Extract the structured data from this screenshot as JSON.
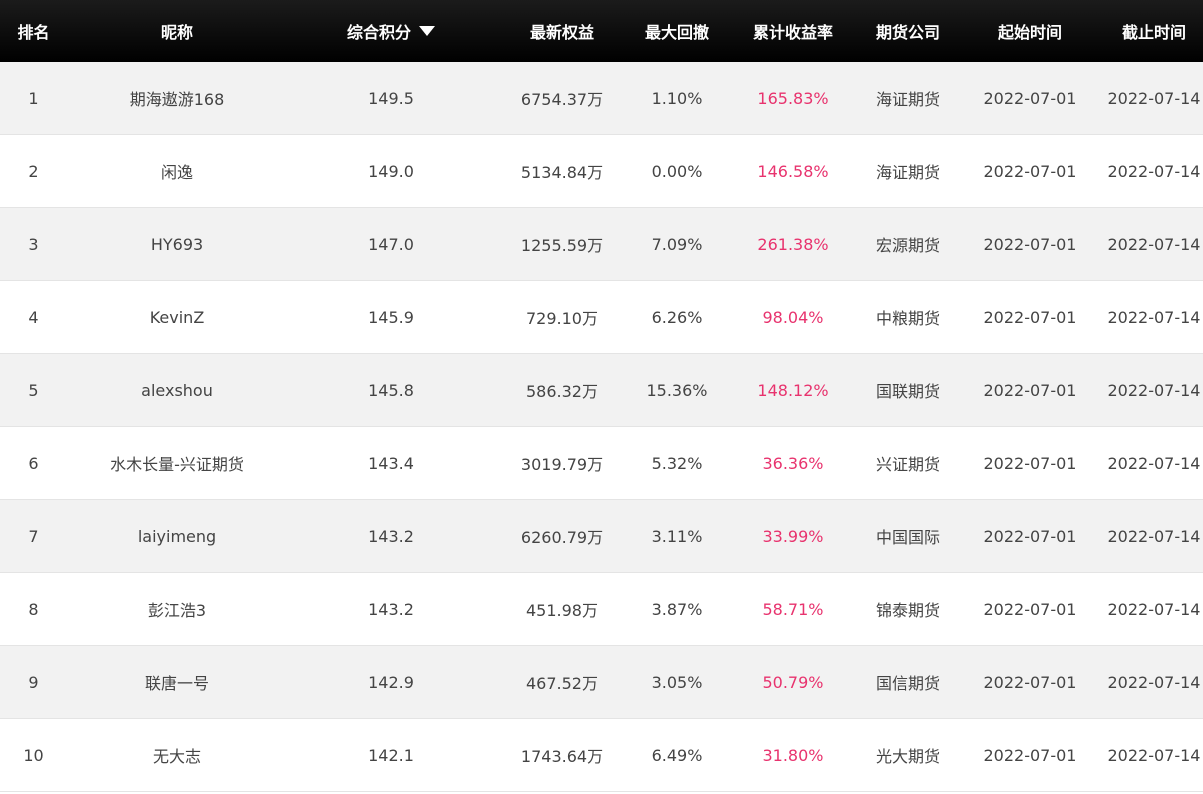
{
  "headers": {
    "rank": "排名",
    "name": "昵称",
    "score": "综合积分",
    "equity": "最新权益",
    "drawdown": "最大回撤",
    "return": "累计收益率",
    "company": "期货公司",
    "start": "起始时间",
    "end": "截止时间"
  },
  "rows": [
    {
      "rank": "1",
      "name": "期海遨游168",
      "score": "149.5",
      "equity": "6754.37万",
      "drawdown": "1.10%",
      "return": "165.83%",
      "company": "海证期货",
      "start": "2022-07-01",
      "end": "2022-07-14"
    },
    {
      "rank": "2",
      "name": "闲逸",
      "score": "149.0",
      "equity": "5134.84万",
      "drawdown": "0.00%",
      "return": "146.58%",
      "company": "海证期货",
      "start": "2022-07-01",
      "end": "2022-07-14"
    },
    {
      "rank": "3",
      "name": "HY693",
      "score": "147.0",
      "equity": "1255.59万",
      "drawdown": "7.09%",
      "return": "261.38%",
      "company": "宏源期货",
      "start": "2022-07-01",
      "end": "2022-07-14"
    },
    {
      "rank": "4",
      "name": "KevinZ",
      "score": "145.9",
      "equity": "729.10万",
      "drawdown": "6.26%",
      "return": "98.04%",
      "company": "中粮期货",
      "start": "2022-07-01",
      "end": "2022-07-14"
    },
    {
      "rank": "5",
      "name": "alexshou",
      "score": "145.8",
      "equity": "586.32万",
      "drawdown": "15.36%",
      "return": "148.12%",
      "company": "国联期货",
      "start": "2022-07-01",
      "end": "2022-07-14"
    },
    {
      "rank": "6",
      "name": "水木长量-兴证期货",
      "score": "143.4",
      "equity": "3019.79万",
      "drawdown": "5.32%",
      "return": "36.36%",
      "company": "兴证期货",
      "start": "2022-07-01",
      "end": "2022-07-14"
    },
    {
      "rank": "7",
      "name": "laiyimeng",
      "score": "143.2",
      "equity": "6260.79万",
      "drawdown": "3.11%",
      "return": "33.99%",
      "company": "中国国际",
      "start": "2022-07-01",
      "end": "2022-07-14"
    },
    {
      "rank": "8",
      "name": "彭江浩3",
      "score": "143.2",
      "equity": "451.98万",
      "drawdown": "3.87%",
      "return": "58.71%",
      "company": "锦泰期货",
      "start": "2022-07-01",
      "end": "2022-07-14"
    },
    {
      "rank": "9",
      "name": "联唐一号",
      "score": "142.9",
      "equity": "467.52万",
      "drawdown": "3.05%",
      "return": "50.79%",
      "company": "国信期货",
      "start": "2022-07-01",
      "end": "2022-07-14"
    },
    {
      "rank": "10",
      "name": "无大志",
      "score": "142.1",
      "equity": "1743.64万",
      "drawdown": "6.49%",
      "return": "31.80%",
      "company": "光大期货",
      "start": "2022-07-01",
      "end": "2022-07-14"
    }
  ],
  "colors": {
    "header_bg": "#000000",
    "row_alt_bg": "#f2f2f2",
    "return_color": "#e8336e"
  },
  "icons": {
    "sort": "sort-desc-icon"
  }
}
